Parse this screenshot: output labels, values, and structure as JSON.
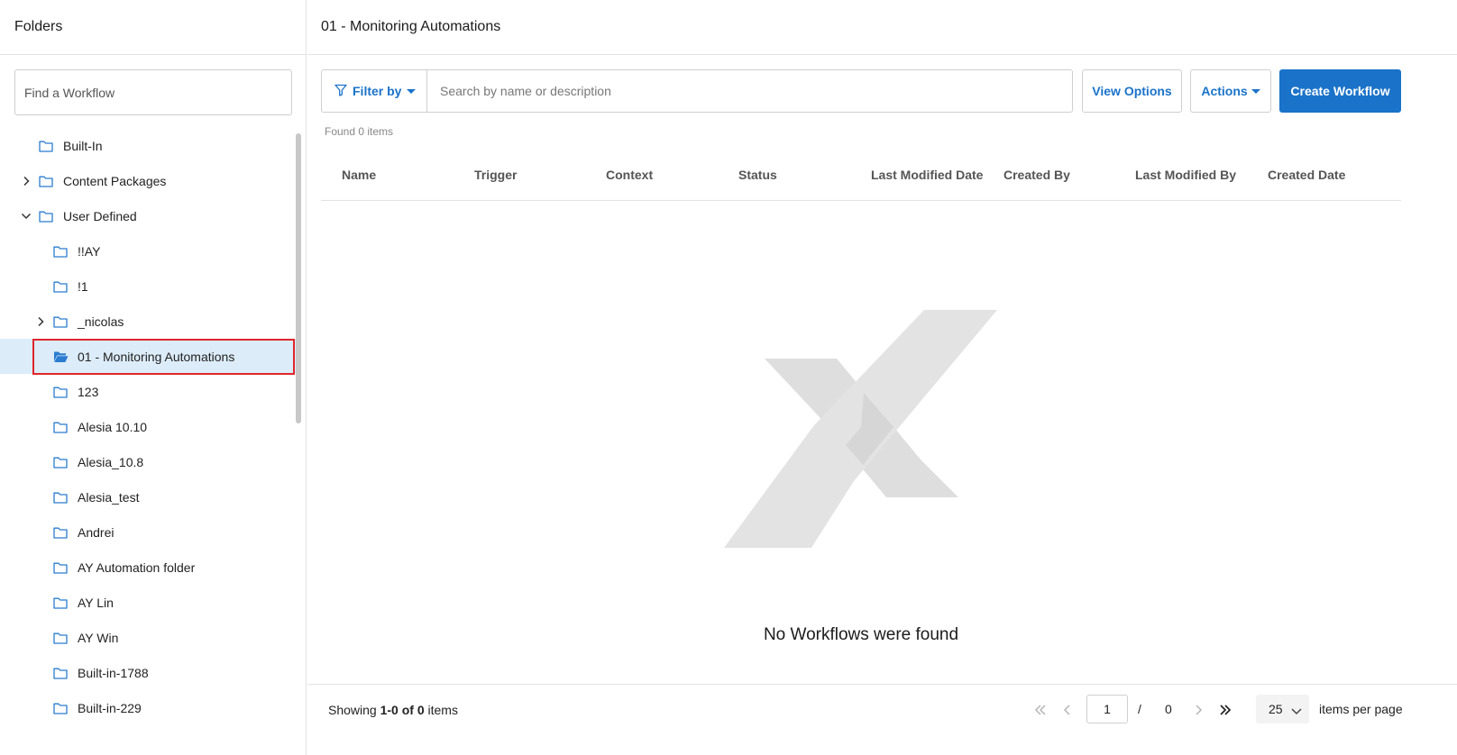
{
  "sidebar": {
    "title": "Folders",
    "search_placeholder": "Find a Workflow",
    "tree": [
      {
        "label": "Built-In",
        "level": 0,
        "chevron": "none",
        "selected": false
      },
      {
        "label": "Content Packages",
        "level": 0,
        "chevron": "right",
        "selected": false
      },
      {
        "label": "User Defined",
        "level": 0,
        "chevron": "down",
        "selected": false
      },
      {
        "label": "!!AY",
        "level": 1,
        "chevron": "none",
        "selected": false
      },
      {
        "label": "!1",
        "level": 1,
        "chevron": "none",
        "selected": false
      },
      {
        "label": "_nicolas",
        "level": 1,
        "chevron": "right",
        "selected": false
      },
      {
        "label": "01 - Monitoring Automations",
        "level": 1,
        "chevron": "none",
        "selected": true
      },
      {
        "label": "123",
        "level": 1,
        "chevron": "none",
        "selected": false
      },
      {
        "label": "Alesia 10.10",
        "level": 1,
        "chevron": "none",
        "selected": false
      },
      {
        "label": "Alesia_10.8",
        "level": 1,
        "chevron": "none",
        "selected": false
      },
      {
        "label": "Alesia_test",
        "level": 1,
        "chevron": "none",
        "selected": false
      },
      {
        "label": "Andrei",
        "level": 1,
        "chevron": "none",
        "selected": false
      },
      {
        "label": "AY Automation folder",
        "level": 1,
        "chevron": "none",
        "selected": false
      },
      {
        "label": "AY Lin",
        "level": 1,
        "chevron": "none",
        "selected": false
      },
      {
        "label": "AY Win",
        "level": 1,
        "chevron": "none",
        "selected": false
      },
      {
        "label": "Built-in-1788",
        "level": 1,
        "chevron": "none",
        "selected": false
      },
      {
        "label": "Built-in-229",
        "level": 1,
        "chevron": "none",
        "selected": false
      }
    ]
  },
  "main": {
    "title": "01 - Monitoring Automations",
    "filter_label": "Filter by",
    "search_placeholder": "Search by name or description",
    "view_options_label": "View Options",
    "actions_label": "Actions",
    "create_label": "Create Workflow",
    "found_text": "Found 0 items",
    "columns": [
      "Name",
      "Trigger",
      "Context",
      "Status",
      "Last Modified Date",
      "Created By",
      "Last Modified By",
      "Created Date"
    ],
    "empty_text": "No Workflows were found"
  },
  "footer": {
    "showing_prefix": "Showing ",
    "showing_range": "1-0",
    "showing_of": " of ",
    "showing_total": "0",
    "showing_suffix": " items",
    "page_value": "1",
    "slash": "/",
    "total_pages": "0",
    "per_page": "25",
    "per_page_label": "items per page"
  },
  "colors": {
    "accent": "#1a73c9",
    "selected_bg": "#dcecf9",
    "highlight_border": "#e0262b",
    "logo_gray": "#dedede"
  },
  "icons": [
    "folder-icon",
    "folder-open-icon",
    "chevron-right-icon",
    "chevron-down-icon",
    "filter-icon",
    "caret-down-icon",
    "first-page-icon",
    "prev-page-icon",
    "next-page-icon",
    "last-page-icon"
  ]
}
